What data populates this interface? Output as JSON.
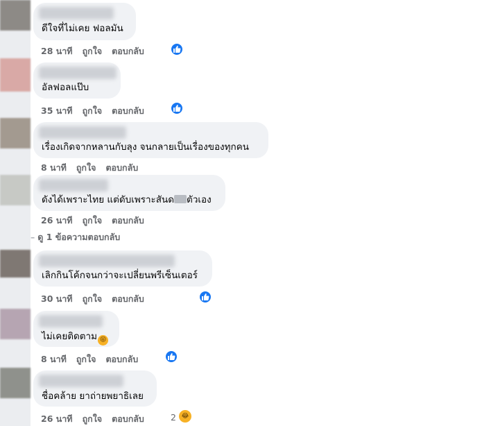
{
  "comments": [
    {
      "text": "ดีใจที่ไม่เคย ฟอลมัน",
      "time": "28 นาที",
      "like": "ถูกใจ",
      "reply": "ตอบกลับ"
    },
    {
      "text": "อัลฟอลแป๊บ",
      "time": "35 นาที",
      "like": "ถูกใจ",
      "reply": "ตอบกลับ"
    },
    {
      "text": "เรื่องเกิดจากหลานกับลุง จนกลายเป็นเรื่องของทุกคน",
      "time": "8 นาที",
      "like": "ถูกใจ",
      "reply": "ตอบกลับ"
    },
    {
      "text_before": "ดังได้เพราะไทย แต่ดับเพราะสันด",
      "text_after": "ตัวเอง",
      "time": "26 นาที",
      "like": "ถูกใจ",
      "reply": "ตอบกลับ"
    },
    {
      "text": "เลิกกินโค้กจนกว่าจะเปลี่ยนพรีเซ็นเตอร์",
      "time": "30 นาที",
      "like": "ถูกใจ",
      "reply": "ตอบกลับ"
    },
    {
      "text": "ไม่เคยติดตาม",
      "time": "8 นาที",
      "like": "ถูกใจ",
      "reply": "ตอบกลับ"
    },
    {
      "text": "ชื่อคล้าย ยาถ่ายพยาธิเลย",
      "time": "26 นาที",
      "like": "ถูกใจ",
      "reply": "ตอบกลับ",
      "reaction_count": "2"
    }
  ],
  "view_replies": "ดู 1 ข้อความตอบกลับ",
  "colors": {
    "bubble": "#f0f2f5",
    "like_blue": "#1877f2",
    "meta_gray": "#65676b",
    "emoji_yellow": "#f7b125"
  },
  "icons": {
    "like": "thumbs-up-icon",
    "haha": "laughing-emoji-icon",
    "tongue": "tongue-emoji-icon"
  }
}
